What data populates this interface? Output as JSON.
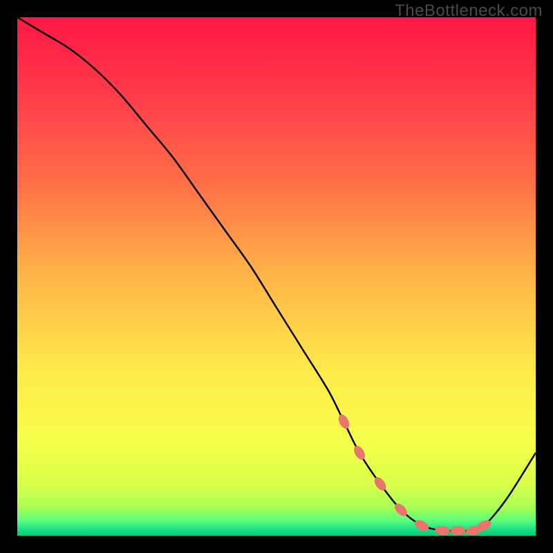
{
  "watermark": "TheBottleneck.com",
  "chart_data": {
    "type": "line",
    "title": "",
    "xlabel": "",
    "ylabel": "",
    "xlim": [
      0,
      100
    ],
    "ylim": [
      0,
      100
    ],
    "series": [
      {
        "name": "bottleneck-curve",
        "x": [
          0,
          5,
          10,
          15,
          20,
          25,
          30,
          35,
          40,
          45,
          50,
          55,
          60,
          63,
          66,
          70,
          74,
          78,
          82,
          85,
          88,
          90,
          92,
          95,
          100
        ],
        "values": [
          100,
          97,
          94,
          90,
          85,
          79,
          73,
          66,
          59,
          52,
          44,
          36,
          28,
          22,
          16,
          10,
          5,
          2,
          1,
          1,
          1,
          2,
          4,
          8,
          16
        ]
      }
    ],
    "markers": {
      "description": "coral oval markers along curve near trough",
      "x": [
        63,
        66,
        70,
        74,
        78,
        82,
        85,
        88,
        90
      ],
      "values": [
        22,
        16,
        10,
        5,
        2,
        1,
        1,
        1,
        2
      ]
    },
    "gradient_stops": [
      {
        "offset": 0.0,
        "color": "#ff1744"
      },
      {
        "offset": 0.15,
        "color": "#ff3b4a"
      },
      {
        "offset": 0.32,
        "color": "#ff6f47"
      },
      {
        "offset": 0.5,
        "color": "#ffb547"
      },
      {
        "offset": 0.68,
        "color": "#ffe94a"
      },
      {
        "offset": 0.82,
        "color": "#f6ff4a"
      },
      {
        "offset": 0.9,
        "color": "#d9ff4a"
      },
      {
        "offset": 0.945,
        "color": "#aaff55"
      },
      {
        "offset": 0.97,
        "color": "#5eff7a"
      },
      {
        "offset": 0.985,
        "color": "#22e58a"
      },
      {
        "offset": 1.0,
        "color": "#06c97a"
      }
    ],
    "marker_color": "#e8766a",
    "curve_color": "#000000"
  }
}
